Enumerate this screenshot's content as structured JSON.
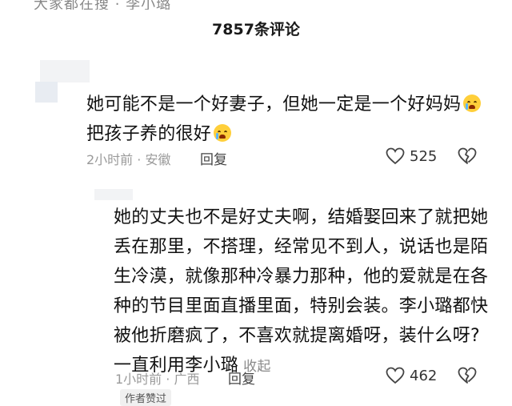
{
  "top_bar": {
    "cut_text": "大家都在搜 · 李小璐"
  },
  "header": {
    "title": "7857条评论"
  },
  "comments": [
    {
      "lines": [
        "她可能不是一个好妻子，但她一定是一个好妈妈",
        "把孩子养的很好"
      ],
      "time": "2小时前",
      "location": "安徽",
      "reply_label": "回复",
      "likes": "525"
    },
    {
      "lines": [
        "她的丈夫也不是好丈夫啊，结婚娶回来了就把她",
        "丢在那里，不搭理，经常见不到人，说话也是陌",
        "生冷漠，就像那种冷暴力那种，他的爱就是在各",
        "种的节目里面直播里面，特别会装。李小璐都快",
        "被他折磨疯了，不喜欢就提离婚呀，装什么呀?",
        "一直利用李小璐"
      ],
      "collapse_label": "收起",
      "time": "1小时前",
      "location": "广西",
      "reply_label": "回复",
      "likes": "462",
      "author_liked": "作者赞过"
    }
  ],
  "icons": {
    "emoji": "crying-face-icon",
    "like": "heart-outline-icon",
    "dislike": "broken-heart-icon"
  },
  "colors": {
    "meta_gray": "#9a9a9a",
    "text": "#111111",
    "emoji_yellow": "#ffcf3a"
  }
}
